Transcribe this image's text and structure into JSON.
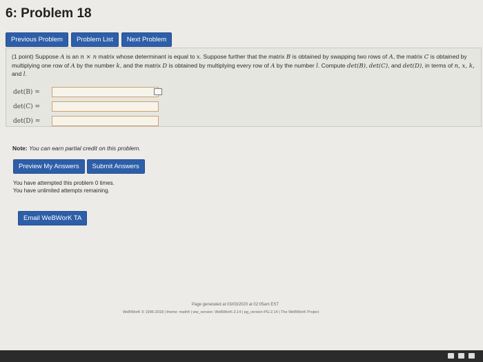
{
  "page": {
    "title": "6: Problem 18"
  },
  "nav": {
    "previous_label": "Previous Problem",
    "list_label": "Problem List",
    "next_label": "Next Problem"
  },
  "problem": {
    "points": "(1 point)",
    "text_part1": "Suppose",
    "A": "A",
    "text_part2": "is an",
    "n": "n × n",
    "text_part3": "matrix whose determinant is equal to",
    "x": "x",
    "text_part4": ". Suppose further that the matrix",
    "B": "B",
    "text_part5": "is obtained by swapping two rows of",
    "A2": "A",
    "text_part6": ", the matrix",
    "C": "C",
    "text_part7": "is obtained by multiplying one row of",
    "A3": "A",
    "text_part8": "by the number",
    "k": "k",
    "text_part9": ", and the matrix",
    "D": "D",
    "text_part10": "is obtained by multiplying every row of",
    "A4": "A",
    "text_part11": "by the number",
    "l": "l",
    "text_part12": ". Compute",
    "detB": "det(B)",
    "detC": "det(C)",
    "text_part13": ", and",
    "detD": "det(D)",
    "text_part14": ", in terms of",
    "vars": "n, x, k,",
    "and": "and",
    "l2": "l",
    "end": "."
  },
  "answers": [
    {
      "label": "det(B) =",
      "value": ""
    },
    {
      "label": "det(C) =",
      "value": ""
    },
    {
      "label": "det(D) =",
      "value": ""
    }
  ],
  "note": {
    "bold": "Note:",
    "text": "You can earn partial credit on this problem."
  },
  "actions": {
    "preview_label": "Preview My Answers",
    "submit_label": "Submit Answers"
  },
  "attempts": {
    "line1": "You have attempted this problem 0 times.",
    "line2": "You have unlimited attempts remaining."
  },
  "email_label": "Email WeBWorK TA",
  "footer": {
    "generated": "Page generated at 03/03/2020 at 02:05am EST",
    "copyright": "WeBWorK © 1996-2018 | theme: math4 | ww_version: WeBWorK-2.14 | pg_version PG-2.14 | The WeBWorK Project"
  }
}
